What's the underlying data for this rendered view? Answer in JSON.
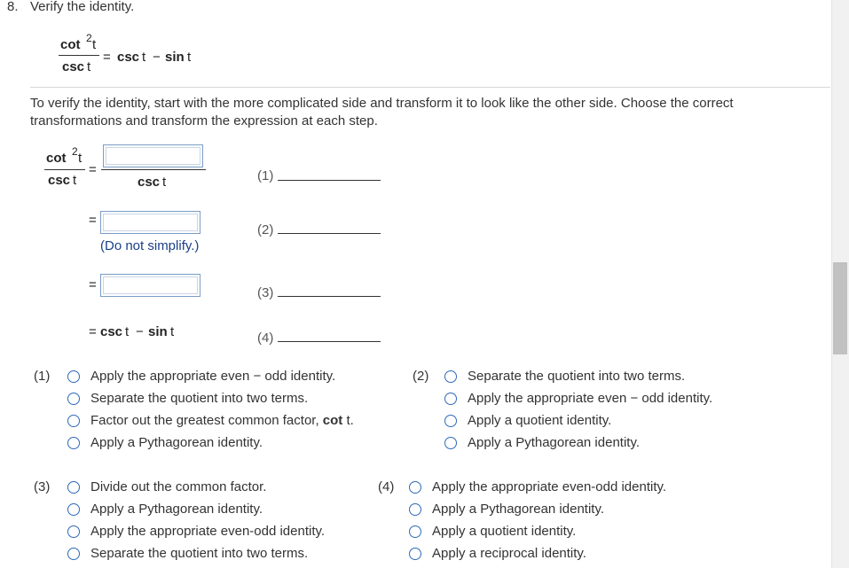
{
  "question": {
    "number": "8.",
    "title": "Verify the identity."
  },
  "identity": {
    "num_func": "cot",
    "num_exp": "2",
    "num_var": "t",
    "den_func": "csc",
    "den_var": "t",
    "equals": "=",
    "rhs_csc": "csc",
    "rhs_t1": "t",
    "rhs_minus": "−",
    "rhs_sin": "sin",
    "rhs_t2": "t"
  },
  "instructions": "To verify the identity, start with the more complicated side and transform it to look like the other side. Choose the correct transformations and transform the expression at each step.",
  "work": {
    "box_den_func": "csc",
    "box_den_var": "t",
    "note": "(Do not simplify.)",
    "final_prefix": "=",
    "steps": [
      "(1)",
      "(2)",
      "(3)",
      "(4)"
    ]
  },
  "groups": [
    {
      "label": "(1)",
      "options": [
        "Apply the appropriate even − odd identity.",
        "Separate the quotient into two terms.",
        "Factor out the greatest common factor,",
        "Apply a Pythagorean identity."
      ],
      "gcf_func": "cot",
      "gcf_var": "t."
    },
    {
      "label": "(2)",
      "options": [
        "Separate the quotient into two terms.",
        "Apply the appropriate even − odd identity.",
        "Apply a quotient identity.",
        "Apply a Pythagorean identity."
      ]
    },
    {
      "label": "(3)",
      "options": [
        "Divide out the common factor.",
        "Apply a Pythagorean identity.",
        "Apply the appropriate even-odd identity.",
        "Separate the quotient into two terms."
      ]
    },
    {
      "label": "(4)",
      "options": [
        "Apply the appropriate even-odd identity.",
        "Apply a Pythagorean identity.",
        "Apply a quotient identity.",
        "Apply a reciprocal identity."
      ]
    }
  ],
  "colors": {
    "radio_border": "#2f69b8",
    "note_text": "#1a3f8a",
    "input_border": "#7a9cc6"
  }
}
